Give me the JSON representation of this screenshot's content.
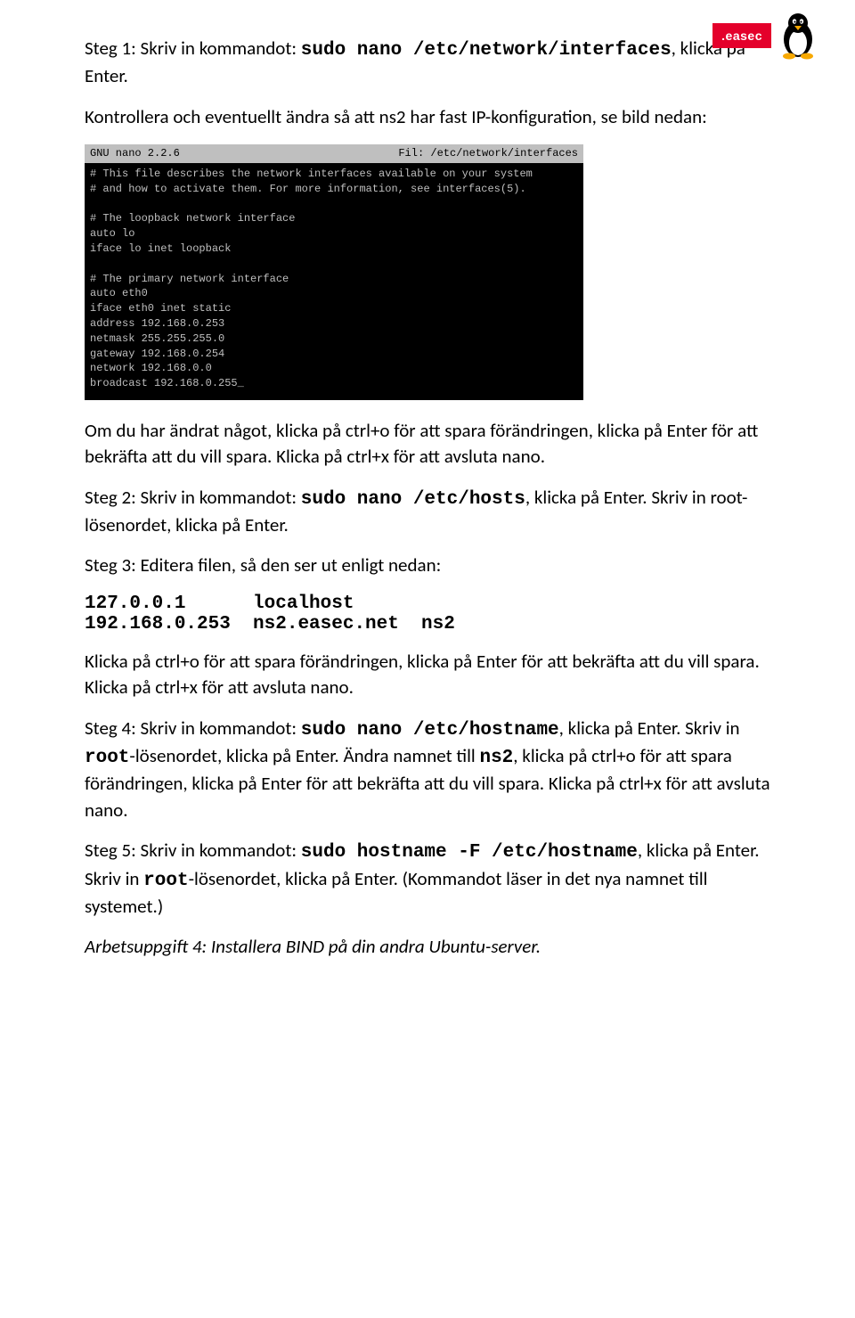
{
  "header": {
    "logo_text": ".easec"
  },
  "step1": {
    "prefix": "Steg 1: Skriv in kommandot: ",
    "cmd": "sudo nano /etc/network/interfaces",
    "suffix": ", klicka på Enter."
  },
  "intro2": "Kontrollera och eventuellt ändra så att ns2 har fast IP-konfiguration, se bild nedan:",
  "terminal": {
    "title_left": "GNU nano 2.2.6",
    "title_right": "Fil: /etc/network/interfaces",
    "body": "# This file describes the network interfaces available on your system\n# and how to activate them. For more information, see interfaces(5).\n\n# The loopback network interface\nauto lo\niface lo inet loopback\n\n# The primary network interface\nauto eth0\niface eth0 inet static\naddress 192.168.0.253\nnetmask 255.255.255.0\ngateway 192.168.0.254\nnetwork 192.168.0.0\nbroadcast 192.168.0.255_"
  },
  "para_after_term": "Om du har ändrat något, klicka på ctrl+o för att spara förändringen, klicka på Enter för att bekräfta att du vill spara. Klicka på ctrl+x för att avsluta nano.",
  "step2": {
    "prefix": "Steg 2: Skriv in kommandot: ",
    "cmd": "sudo nano /etc/hosts",
    "suffix": ", klicka på Enter. Skriv in root-lösenordet, klicka på Enter."
  },
  "step3_intro": "Steg 3: Editera filen, så den ser ut enligt nedan:",
  "hosts_block": "127.0.0.1      localhost\n192.168.0.253  ns2.easec.net  ns2",
  "para_after_hosts": "Klicka på ctrl+o för att spara förändringen, klicka på Enter för att bekräfta att du vill spara. Klicka på ctrl+x för att avsluta nano.",
  "step4": {
    "prefix": "Steg 4: Skriv in kommandot: ",
    "cmd": "sudo nano /etc/hostname",
    "mid1": ", klicka på Enter. Skriv in ",
    "root": "root",
    "mid2": "-lösenordet, klicka på Enter. Ändra namnet till ",
    "ns2": "ns2",
    "suffix": ", klicka på ctrl+o för att spara förändringen, klicka på Enter för att bekräfta att du vill spara. Klicka på ctrl+x för att avsluta nano."
  },
  "step5": {
    "prefix": "Steg 5: Skriv in kommandot: ",
    "cmd": "sudo hostname -F /etc/hostname",
    "mid1": ", klicka på Enter. Skriv in ",
    "root": "root",
    "suffix": "-lösenordet, klicka på Enter. (Kommandot läser in det nya namnet till systemet.)"
  },
  "task4": "Arbetsuppgift 4: Installera BIND på din andra Ubuntu-server."
}
